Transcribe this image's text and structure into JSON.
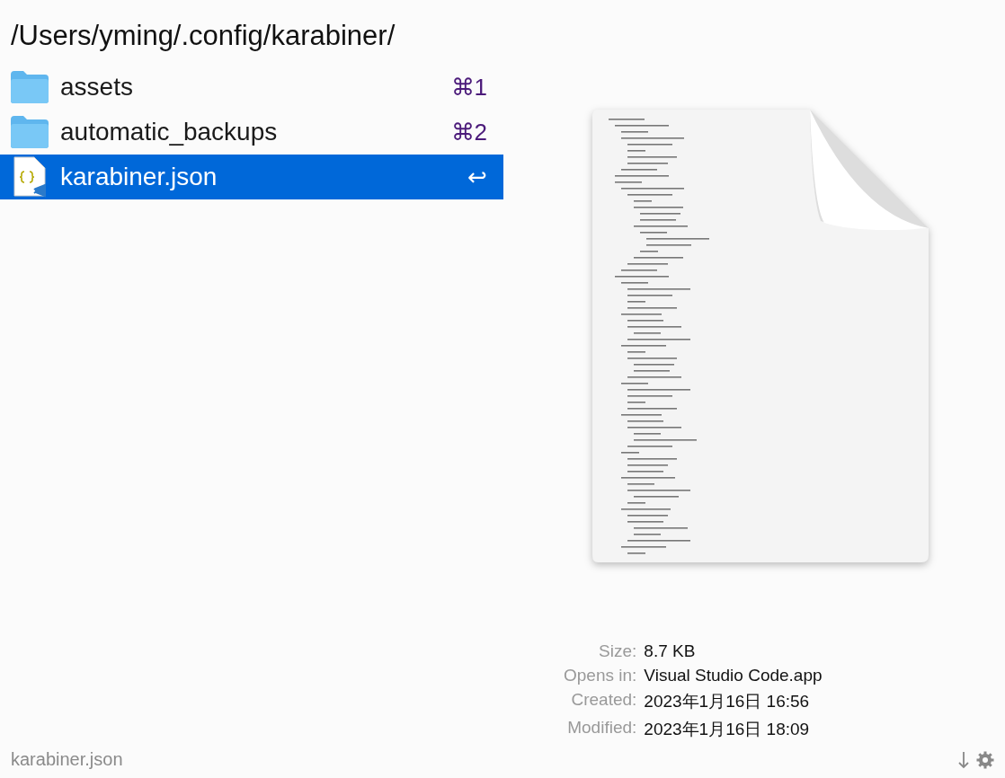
{
  "query": "/Users/yming/.config/karabiner/",
  "results": [
    {
      "kind": "folder",
      "name": "assets",
      "shortcut": "⌘1",
      "selected": false
    },
    {
      "kind": "folder",
      "name": "automatic_backups",
      "shortcut": "⌘2",
      "selected": false
    },
    {
      "kind": "json",
      "name": "karabiner.json",
      "shortcut": "↩",
      "selected": true
    }
  ],
  "details": [
    {
      "label": "Size:",
      "value": "8.7 KB"
    },
    {
      "label": "Opens in:",
      "value": "Visual Studio Code.app"
    },
    {
      "label": "Created:",
      "value": "2023年1月16日 16:56"
    },
    {
      "label": "Modified:",
      "value": "2023年1月16日 18:09"
    }
  ],
  "footer": {
    "path": "karabiner.json"
  }
}
